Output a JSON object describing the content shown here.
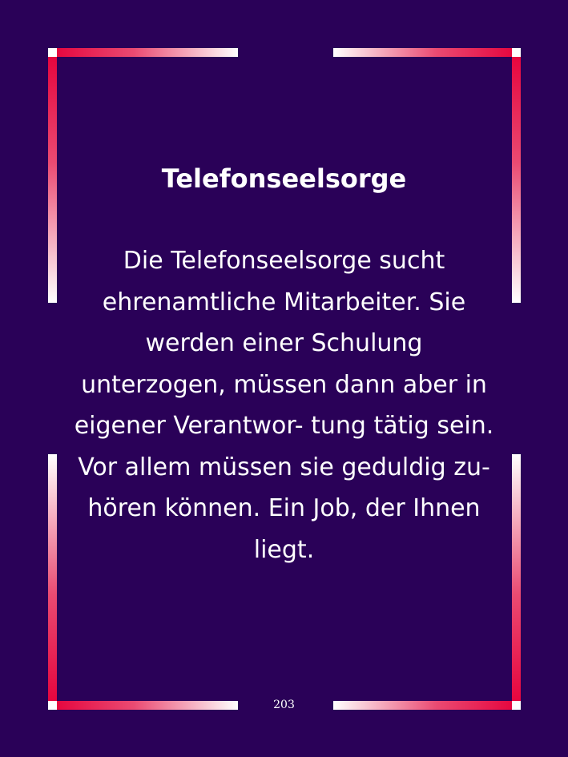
{
  "page": {
    "title": "Telefonseelsorge",
    "body": "Die Telefonseelsorge sucht ehrenamtliche Mitarbeiter. Sie werden einer Schulung unterzogen, müssen dann aber in eigener Verantwor- tung tätig sein. Vor allem müssen sie geduldig zu- hören können. Ein Job, der Ihnen liegt.",
    "page_number": "203"
  },
  "colors": {
    "background": "#2a0158",
    "frame_accent": "#e5003a",
    "frame_light": "#ffffff",
    "text": "#ffffff"
  }
}
